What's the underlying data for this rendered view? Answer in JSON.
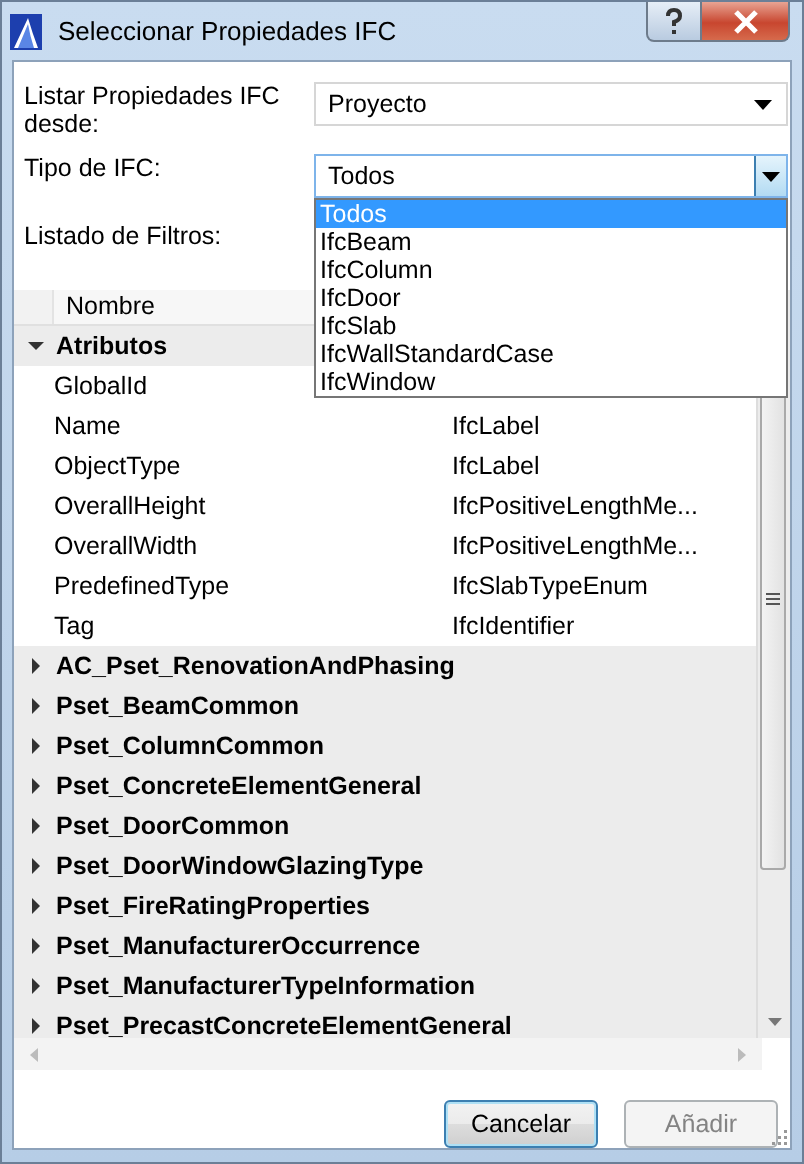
{
  "window": {
    "title": "Seleccionar Propiedades IFC"
  },
  "source": {
    "label": "Listar Propiedades IFC desde:",
    "value": "Proyecto"
  },
  "ifc_type": {
    "label": "Tipo de IFC:",
    "value": "Todos",
    "expanded": true,
    "options": [
      {
        "label": "Todos",
        "selected": true
      },
      {
        "label": "IfcBeam",
        "selected": false
      },
      {
        "label": "IfcColumn",
        "selected": false
      },
      {
        "label": "IfcDoor",
        "selected": false
      },
      {
        "label": "IfcSlab",
        "selected": false
      },
      {
        "label": "IfcWallStandardCase",
        "selected": false
      },
      {
        "label": "IfcWindow",
        "selected": false
      }
    ]
  },
  "filters": {
    "label": "Listado de Filtros:"
  },
  "tree": {
    "columns": [
      "Nombre"
    ],
    "rows": [
      {
        "name": "Atributos",
        "expanded": true,
        "children": [
          {
            "name": "GlobalId"
          },
          {
            "name": "Name",
            "type": "IfcLabel"
          },
          {
            "name": "ObjectType",
            "type": "IfcLabel"
          },
          {
            "name": "OverallHeight",
            "type": "IfcPositiveLengthMe..."
          },
          {
            "name": "OverallWidth",
            "type": "IfcPositiveLengthMe..."
          },
          {
            "name": "PredefinedType",
            "type": "IfcSlabTypeEnum"
          },
          {
            "name": "Tag",
            "type": "IfcIdentifier"
          }
        ]
      },
      {
        "name": "AC_Pset_RenovationAndPhasing",
        "expanded": false
      },
      {
        "name": "Pset_BeamCommon",
        "expanded": false
      },
      {
        "name": "Pset_ColumnCommon",
        "expanded": false
      },
      {
        "name": "Pset_ConcreteElementGeneral",
        "expanded": false
      },
      {
        "name": "Pset_DoorCommon",
        "expanded": false
      },
      {
        "name": "Pset_DoorWindowGlazingType",
        "expanded": false
      },
      {
        "name": "Pset_FireRatingProperties",
        "expanded": false
      },
      {
        "name": "Pset_ManufacturerOccurrence",
        "expanded": false
      },
      {
        "name": "Pset_ManufacturerTypeInformation",
        "expanded": false
      },
      {
        "name": "Pset_PrecastConcreteElementGeneral",
        "expanded": false
      }
    ]
  },
  "buttons": [
    {
      "label": "Cancelar",
      "disabled": false
    },
    {
      "label": "Añadir",
      "disabled": true
    }
  ]
}
